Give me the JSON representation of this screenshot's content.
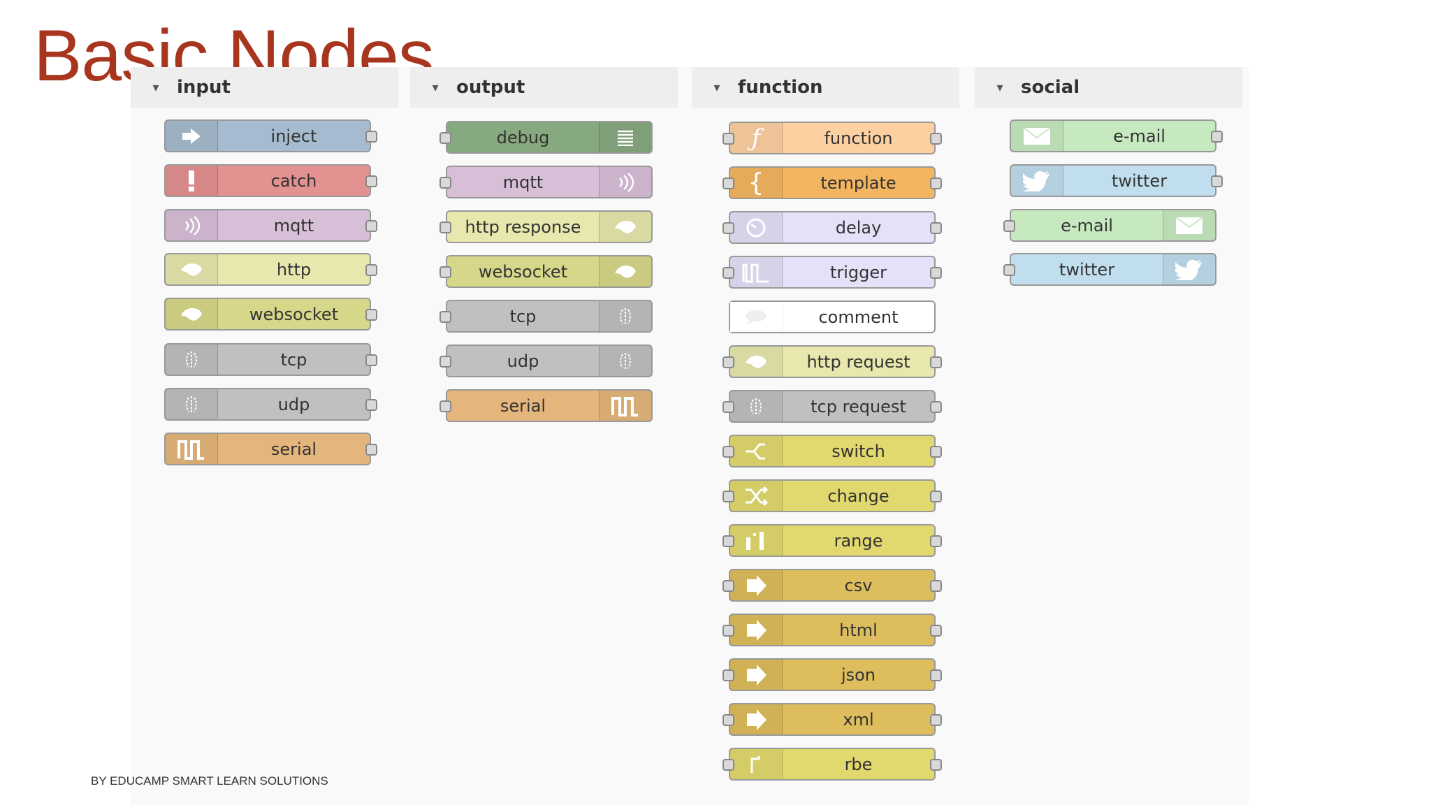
{
  "title": "Basic Nodes",
  "footer": "BY EDUCAMP SMART LEARN SOLUTIONS",
  "categories": {
    "input": {
      "label": "input",
      "nodes": [
        {
          "label": "inject",
          "color": "#a6bbcf",
          "icon": "arrow-right-icon"
        },
        {
          "label": "catch",
          "color": "#e49191",
          "icon": "exclamation-icon"
        },
        {
          "label": "mqtt",
          "color": "#d8bfd8",
          "icon": "radio-waves-icon"
        },
        {
          "label": "http",
          "color": "#e7e7ae",
          "icon": "globe-icon"
        },
        {
          "label": "websocket",
          "color": "#d7d78a",
          "icon": "globe-icon"
        },
        {
          "label": "tcp",
          "color": "#c0c0c0",
          "icon": "bridge-icon"
        },
        {
          "label": "udp",
          "color": "#c0c0c0",
          "icon": "bridge-icon"
        },
        {
          "label": "serial",
          "color": "#e5b67c",
          "icon": "serial-pulse-icon"
        }
      ]
    },
    "output": {
      "label": "output",
      "nodes": [
        {
          "label": "debug",
          "color": "#87a980",
          "icon": "list-icon"
        },
        {
          "label": "mqtt",
          "color": "#d8bfd8",
          "icon": "radio-waves-icon"
        },
        {
          "label": "http response",
          "color": "#e7e7ae",
          "icon": "globe-icon"
        },
        {
          "label": "websocket",
          "color": "#d7d78a",
          "icon": "globe-icon"
        },
        {
          "label": "tcp",
          "color": "#c0c0c0",
          "icon": "bridge-icon"
        },
        {
          "label": "udp",
          "color": "#c0c0c0",
          "icon": "bridge-icon"
        },
        {
          "label": "serial",
          "color": "#e5b67c",
          "icon": "serial-pulse-icon"
        }
      ]
    },
    "function": {
      "label": "function",
      "nodes": [
        {
          "label": "function",
          "color": "#fdd0a2",
          "icon": "function-icon"
        },
        {
          "label": "template",
          "color": "#f4b560",
          "icon": "brace-icon"
        },
        {
          "label": "delay",
          "color": "#e6e0f8",
          "icon": "timer-icon"
        },
        {
          "label": "trigger",
          "color": "#e6e0f8",
          "icon": "trigger-pulse-icon"
        },
        {
          "label": "comment",
          "color": "#ffffff",
          "icon": "comment-icon"
        },
        {
          "label": "http request",
          "color": "#e7e7ae",
          "icon": "globe-icon"
        },
        {
          "label": "tcp request",
          "color": "#c0c0c0",
          "icon": "bridge-icon"
        },
        {
          "label": "switch",
          "color": "#e2d96e",
          "icon": "switch-icon"
        },
        {
          "label": "change",
          "color": "#e2d96e",
          "icon": "shuffle-icon"
        },
        {
          "label": "range",
          "color": "#e2d96e",
          "icon": "range-icon"
        },
        {
          "label": "csv",
          "color": "#debd5c",
          "icon": "arrow-icon"
        },
        {
          "label": "html",
          "color": "#debd5c",
          "icon": "arrow-icon"
        },
        {
          "label": "json",
          "color": "#debd5c",
          "icon": "arrow-icon"
        },
        {
          "label": "xml",
          "color": "#debd5c",
          "icon": "arrow-icon"
        },
        {
          "label": "rbe",
          "color": "#e2d96e",
          "icon": "rbe-icon"
        }
      ]
    },
    "social": {
      "label": "social",
      "nodes": [
        {
          "label": "e-mail",
          "color": "#c7e9c0",
          "icon": "envelope-icon"
        },
        {
          "label": "twitter",
          "color": "#c0deed",
          "icon": "twitter-bird-icon"
        },
        {
          "label": "e-mail",
          "color": "#c7e9c0",
          "icon": "envelope-icon"
        },
        {
          "label": "twitter",
          "color": "#c0deed",
          "icon": "twitter-bird-icon"
        }
      ]
    }
  }
}
